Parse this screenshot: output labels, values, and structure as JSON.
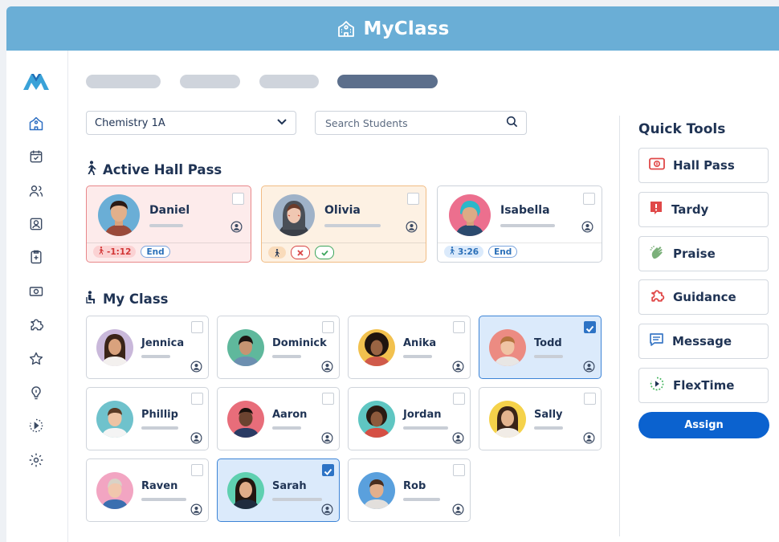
{
  "app": {
    "title": "MyClass"
  },
  "sidebar": {
    "icons": [
      "school-icon",
      "calendar-check-icon",
      "users-icon",
      "id-card-icon",
      "clipboard-icon",
      "ticket-icon",
      "puzzle-icon",
      "star-icon",
      "lightbulb-icon",
      "flextime-icon",
      "settings-icon"
    ]
  },
  "controls": {
    "class_select": "Chemistry 1A",
    "search_placeholder": "Search Students"
  },
  "hall_pass": {
    "title": "Active Hall Pass",
    "cards": [
      {
        "name": "Daniel",
        "status": "red",
        "timer": "-1:12",
        "end": "End"
      },
      {
        "name": "Olivia",
        "status": "orange"
      },
      {
        "name": "Isabella",
        "status": "normal",
        "timer": "3:26",
        "end": "End"
      }
    ]
  },
  "my_class": {
    "title": "My Class",
    "students": [
      {
        "name": "Jennica",
        "selected": false
      },
      {
        "name": "Dominick",
        "selected": false
      },
      {
        "name": "Anika",
        "selected": false
      },
      {
        "name": "Todd",
        "selected": true
      },
      {
        "name": "Phillip",
        "selected": false
      },
      {
        "name": "Aaron",
        "selected": false
      },
      {
        "name": "Jordan",
        "selected": false
      },
      {
        "name": "Sally",
        "selected": false
      },
      {
        "name": "Raven",
        "selected": false
      },
      {
        "name": "Sarah",
        "selected": true
      },
      {
        "name": "Rob",
        "selected": false
      }
    ]
  },
  "quick_tools": {
    "title": "Quick Tools",
    "items": [
      {
        "label": "Hall Pass",
        "icon": "ticket-icon"
      },
      {
        "label": "Tardy",
        "icon": "alert-icon"
      },
      {
        "label": "Praise",
        "icon": "clap-icon"
      },
      {
        "label": "Guidance",
        "icon": "puzzle-icon"
      },
      {
        "label": "Message",
        "icon": "message-icon"
      },
      {
        "label": "FlexTime",
        "icon": "flextime-icon"
      }
    ],
    "assign": "Assign"
  },
  "colors": {
    "brand": "#6aaed6",
    "accent": "#0b62cf",
    "selected_bg": "#dbeafb"
  }
}
